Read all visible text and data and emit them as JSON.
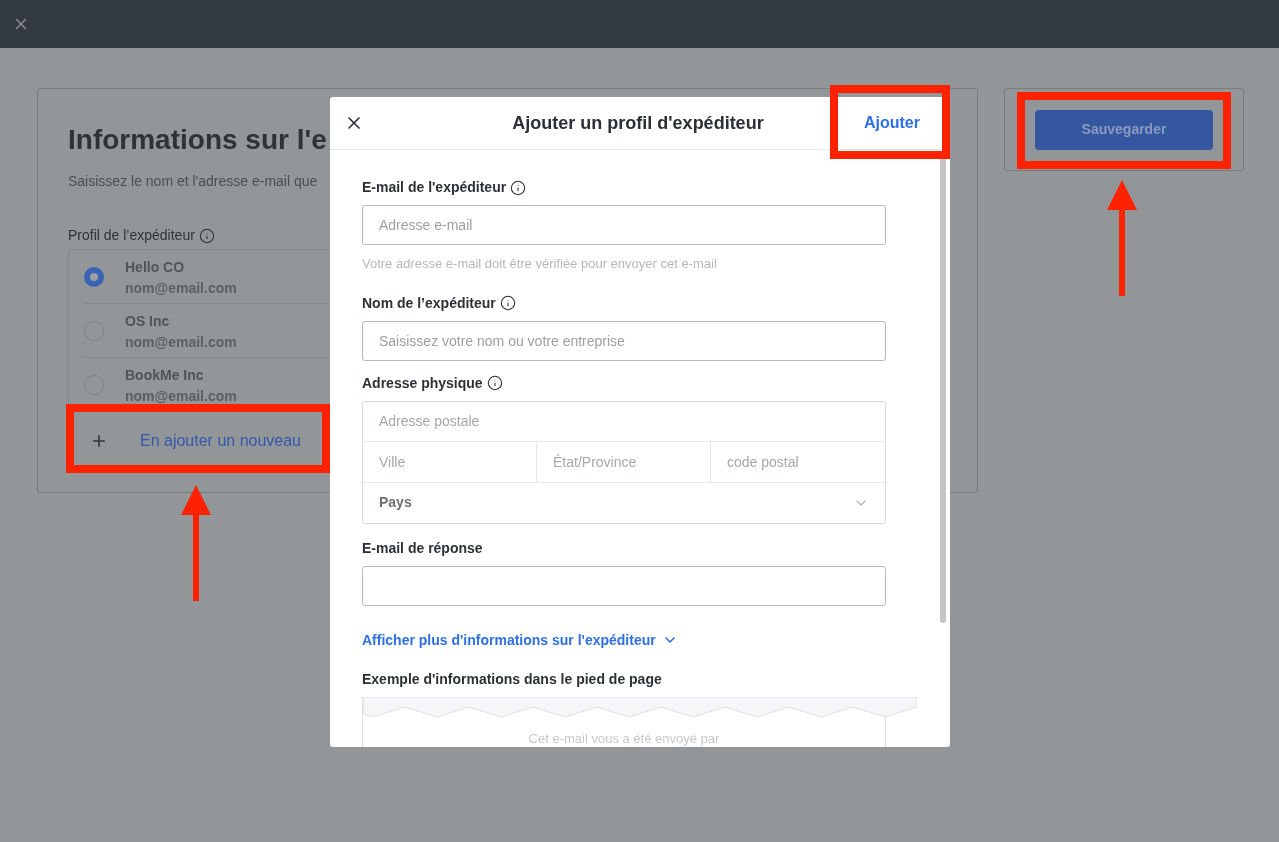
{
  "page": {
    "title": "Informations sur l'e",
    "subtitle": "Saisissez le nom et l'adresse e-mail que",
    "profile_label": "Profil de l’expéditeur",
    "profiles": [
      {
        "name": "Hello CO",
        "email": "nom@email.com",
        "selected": true
      },
      {
        "name": "OS Inc",
        "email": "nom@email.com",
        "selected": false
      },
      {
        "name": "BookMe Inc",
        "email": "nom@email.com",
        "selected": false
      }
    ],
    "add_new": "En ajouter un nouveau"
  },
  "save_button": "Sauvegarder",
  "modal": {
    "title": "Ajouter un profil d'expéditeur",
    "action": "Ajouter",
    "sender_email": {
      "label": "E-mail de l'expéditeur",
      "placeholder": "Adresse e-mail",
      "hint": "Votre adresse e-mail doit être vérifiée pour envoyer cet e-mail"
    },
    "sender_name": {
      "label": "Nom de l’expéditeur",
      "placeholder": "Saisissez votre nom ou votre entreprise"
    },
    "address": {
      "label": "Adresse physique",
      "street_placeholder": "Adresse postale",
      "city_placeholder": "Ville",
      "state_placeholder": "État/Province",
      "zip_placeholder": "code postal",
      "country": "Pays"
    },
    "reply_email": {
      "label": "E-mail de réponse"
    },
    "more_link": "Afficher plus d'informations sur l'expéditeur",
    "footer_preview": {
      "label": "Exemple d'informations dans le pied de page",
      "text": "Cet e-mail vous a été envoyé par"
    }
  }
}
